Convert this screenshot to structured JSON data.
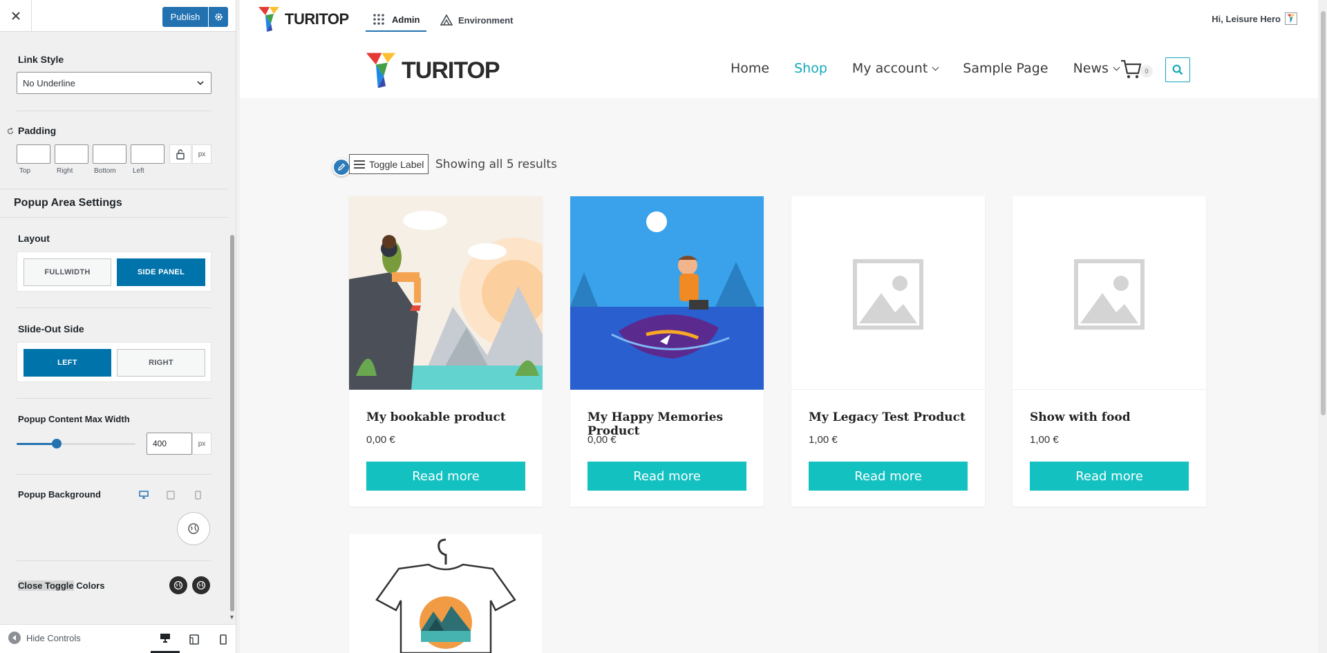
{
  "sidebar": {
    "publish_label": "Publish",
    "link_style": {
      "label": "Link Style",
      "value": "No Underline"
    },
    "padding": {
      "label": "Padding",
      "captions": [
        "Top",
        "Right",
        "Bottom",
        "Left"
      ],
      "unit": "px"
    },
    "popup_section_title": "Popup Area Settings",
    "layout": {
      "label": "Layout",
      "options": [
        "FULLWIDTH",
        "SIDE PANEL"
      ],
      "selected": "SIDE PANEL"
    },
    "slide_side": {
      "label": "Slide-Out Side",
      "options": [
        "LEFT",
        "RIGHT"
      ],
      "selected": "LEFT"
    },
    "max_width": {
      "label": "Popup Content Max Width",
      "value": "400",
      "unit": "px",
      "slider_fraction": 0.34
    },
    "popup_background": {
      "label": "Popup Background"
    },
    "close_toggle": {
      "highlight": "Close Toggle",
      "rest": " Colors"
    },
    "footer": {
      "hide_controls": "Hide Controls"
    }
  },
  "adminbar": {
    "brand": "TURITOP",
    "admin": "Admin",
    "environment": "Environment",
    "greeting": "Hi, Leisure Hero"
  },
  "site": {
    "brand": "TURITOP",
    "nav": [
      "Home",
      "Shop",
      "My account",
      "Sample Page",
      "News"
    ],
    "active_nav": "Shop",
    "cart_count": "0",
    "toggle_label": "Toggle Label",
    "results": "Showing all 5 results"
  },
  "products": [
    {
      "title": "My bookable product",
      "price": "0,00 €",
      "button": "Read more"
    },
    {
      "title": "My Happy Memories Product",
      "price": "0,00 €",
      "button": "Read more"
    },
    {
      "title": "My Legacy Test Product",
      "price": "1,00 €",
      "button": "Read more"
    },
    {
      "title": "Show with food",
      "price": "1,00 €",
      "button": "Read more"
    }
  ],
  "colors": {
    "wp_blue": "#2271b1",
    "option_active": "#0073aa",
    "accent_teal": "#13c1c1",
    "nav_active": "#12a8b9"
  }
}
